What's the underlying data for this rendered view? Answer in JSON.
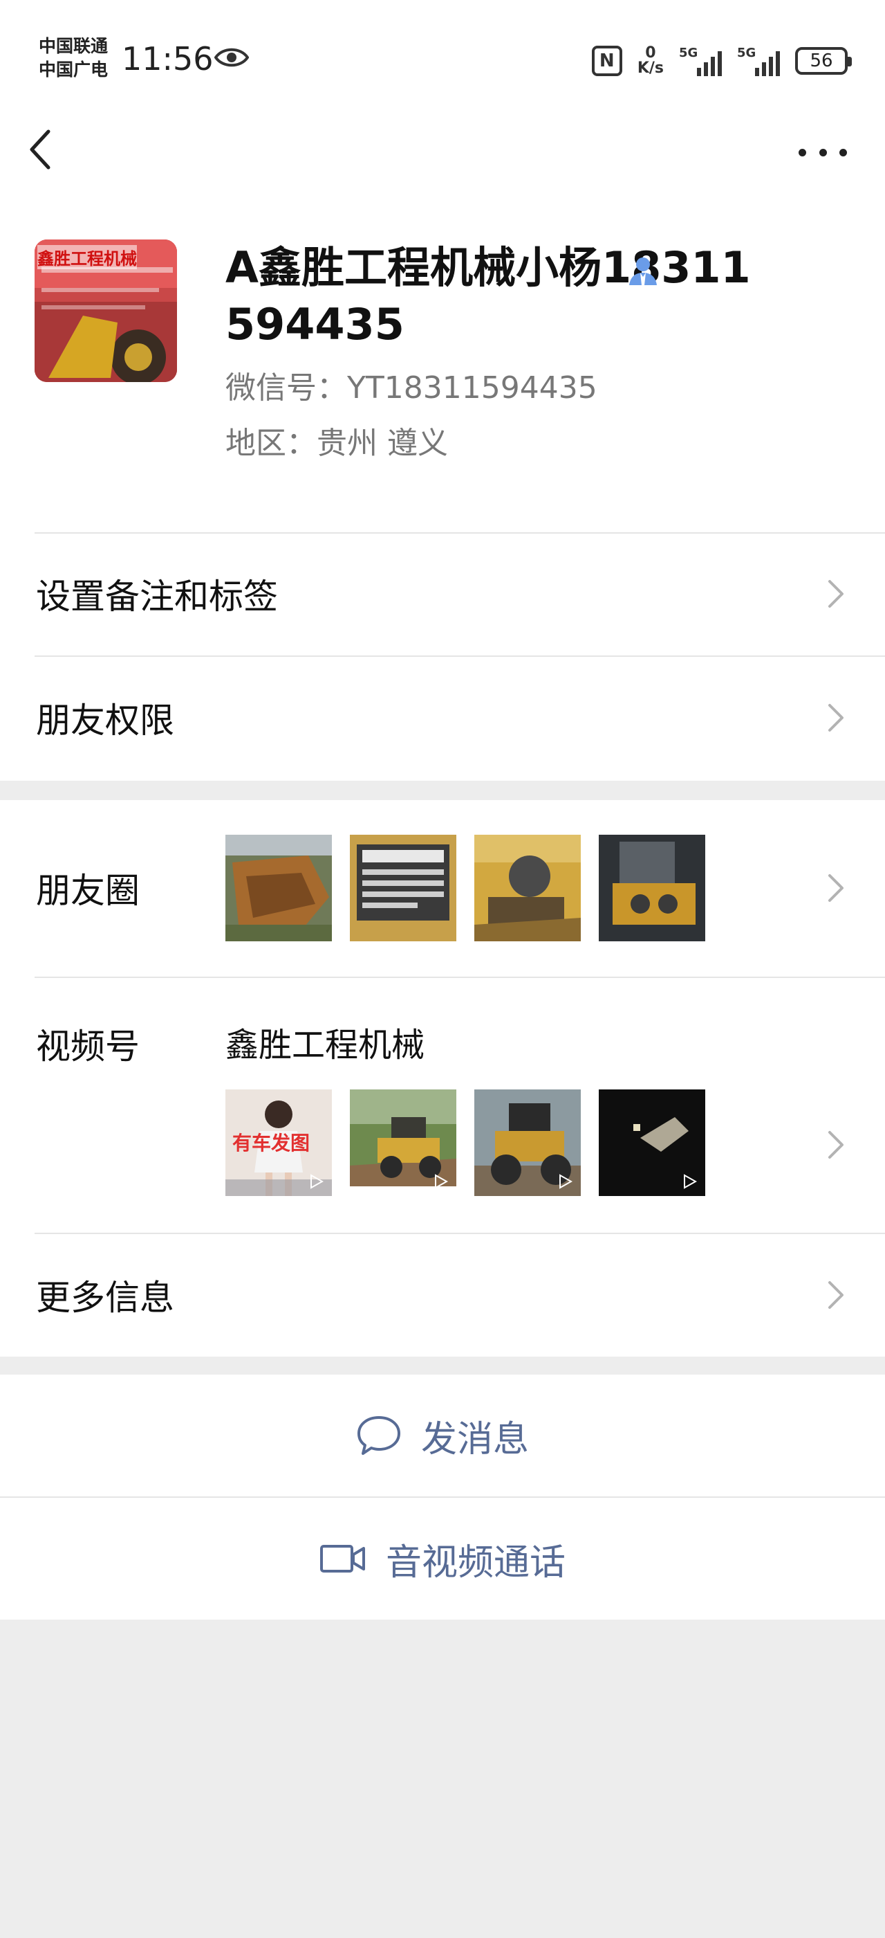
{
  "status_bar": {
    "carrier_1": "中国联通",
    "carrier_2": "中国广电",
    "time": "11:56",
    "net_speed_value": "0",
    "net_speed_unit": "K/s",
    "signal_1_tag": "5G",
    "signal_2_tag": "5G",
    "battery": "56"
  },
  "profile": {
    "name": "A鑫胜工程机械小杨18311594435",
    "wechat_id": "微信号：YT18311594435",
    "region": "地区：贵州  遵义",
    "avatar_text": "鑫胜工程机械"
  },
  "menu": {
    "remark_label": "设置备注和标签",
    "permission_label": "朋友权限",
    "moments_label": "朋友圈",
    "channels_label": "视频号",
    "channels_name": "鑫胜工程机械",
    "channels_thumb_1_text": "有车发图",
    "more_info_label": "更多信息"
  },
  "actions": {
    "message_label": "发消息",
    "call_label": "音视频通话"
  },
  "colors": {
    "link_blue": "#576b95",
    "background": "#ededed",
    "verify_blue": "#6a9ce8"
  }
}
